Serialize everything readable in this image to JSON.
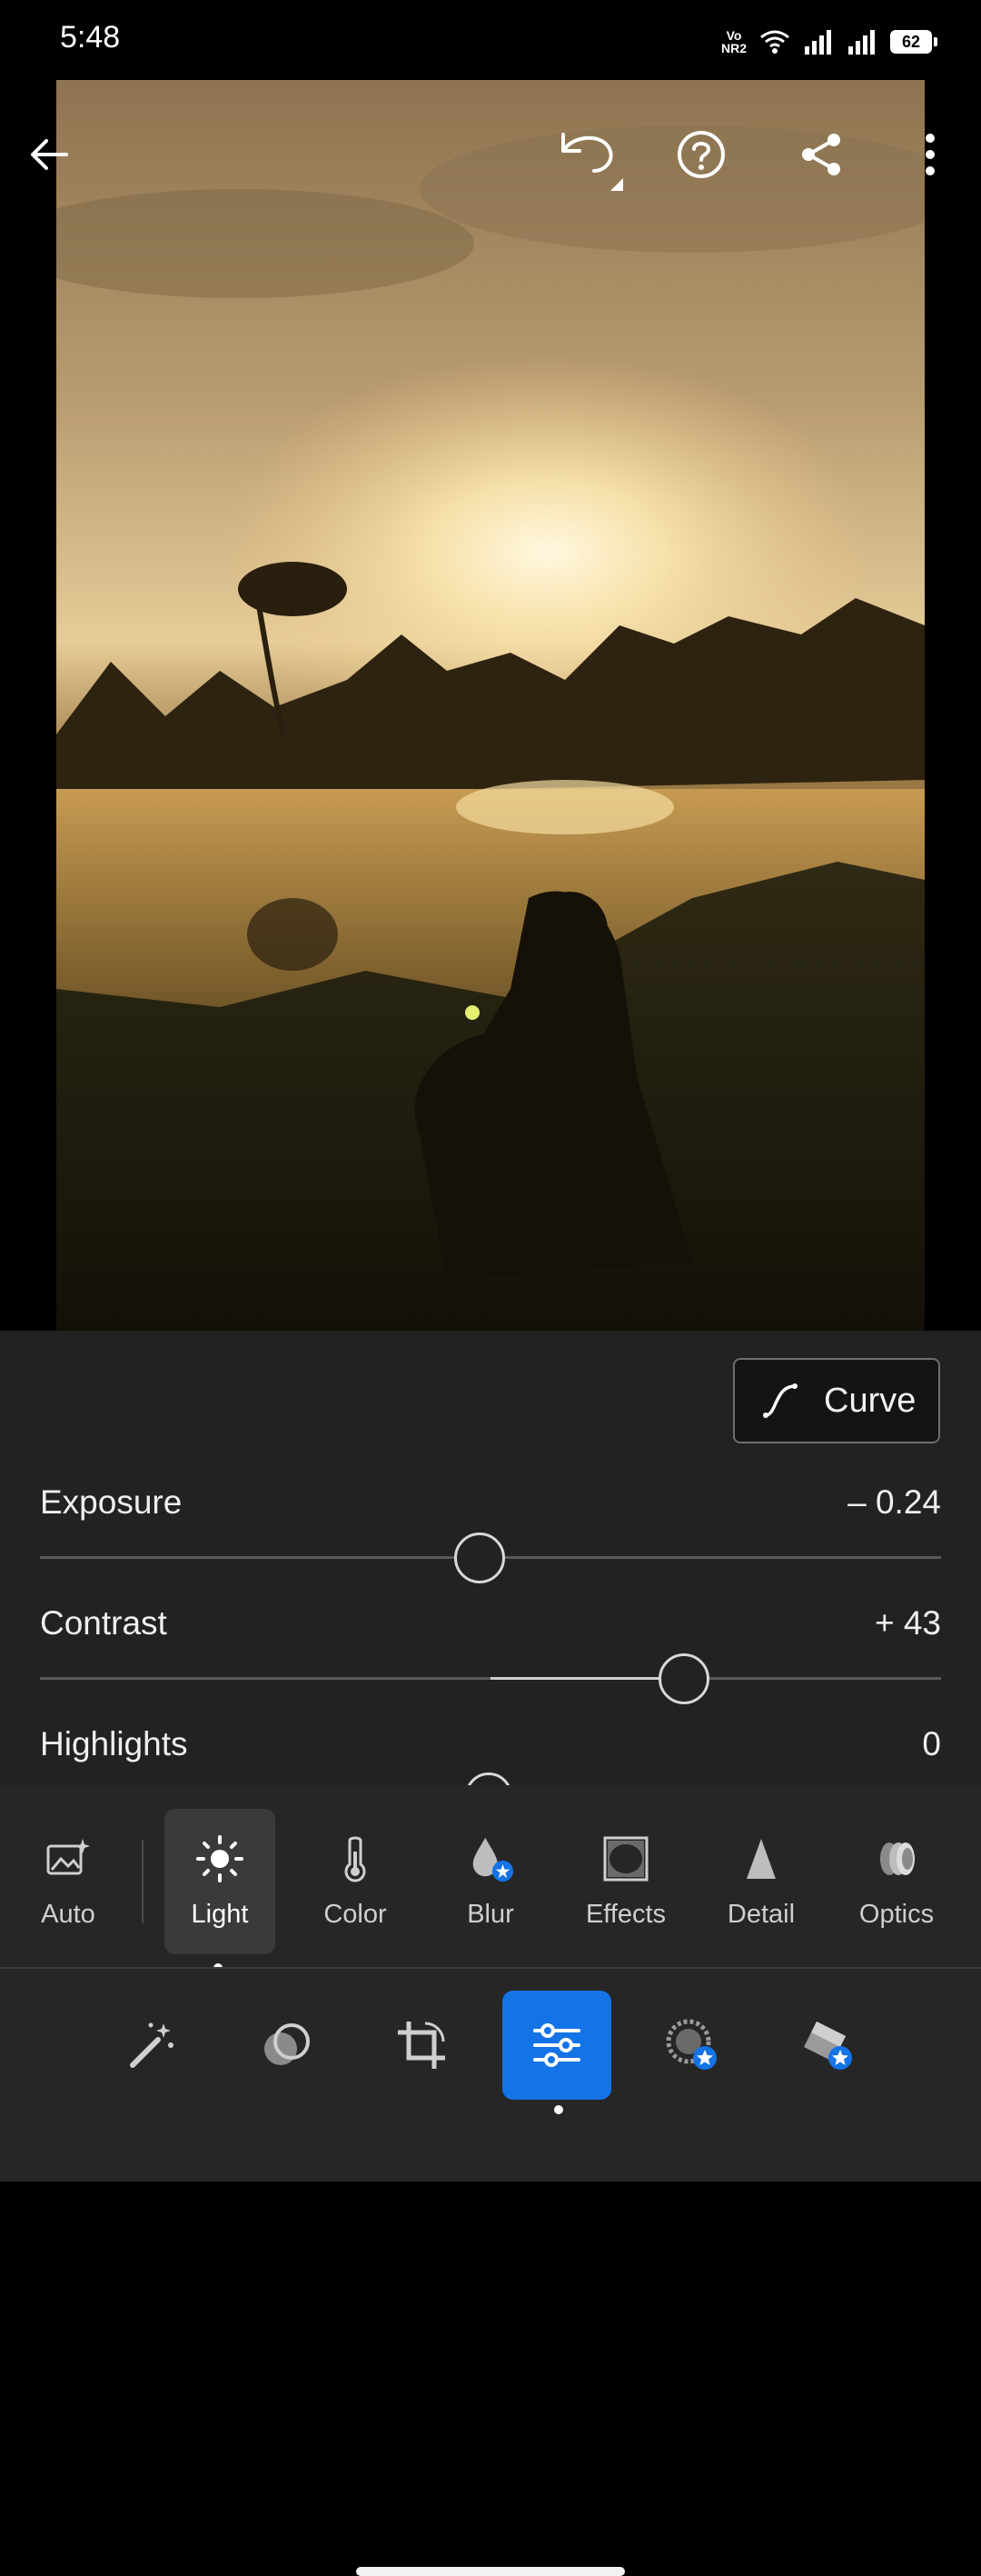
{
  "status_bar": {
    "time": "5:48",
    "network_label_top": "Vo",
    "network_label_bottom": "NR2",
    "battery": "62"
  },
  "toolbar": {
    "icons": [
      "back-arrow-icon",
      "undo-icon",
      "help-icon",
      "share-icon",
      "more-vertical-icon"
    ]
  },
  "curve_button": {
    "label": "Curve"
  },
  "sliders": [
    {
      "label": "Exposure",
      "value": "– 0.24",
      "level": -0.024
    },
    {
      "label": "Contrast",
      "value": "+ 43",
      "level": 0.43
    },
    {
      "label": "Highlights",
      "value": "0",
      "level": 0
    }
  ],
  "tabs": [
    {
      "label": "Auto",
      "icon": "auto-icon"
    },
    {
      "label": "Light",
      "icon": "sun-icon",
      "active": true
    },
    {
      "label": "Color",
      "icon": "thermometer-icon"
    },
    {
      "label": "Blur",
      "icon": "blur-drop-icon",
      "premium": true
    },
    {
      "label": "Effects",
      "icon": "vignette-icon"
    },
    {
      "label": "Detail",
      "icon": "triangle-icon"
    },
    {
      "label": "Optics",
      "icon": "lens-icon"
    }
  ],
  "bottom_nav": [
    {
      "name": "presets",
      "icon": "magic-wand-icon"
    },
    {
      "name": "masking",
      "icon": "mask-circles-icon"
    },
    {
      "name": "crop",
      "icon": "crop-icon"
    },
    {
      "name": "edit",
      "icon": "sliders-icon",
      "active": true
    },
    {
      "name": "healing",
      "icon": "healing-icon",
      "premium": true
    },
    {
      "name": "remove",
      "icon": "eraser-icon",
      "premium": true
    }
  ],
  "colors": {
    "accent": "#1473e6",
    "panel_bg": "#222222",
    "premium_badge": "#1473e6"
  }
}
